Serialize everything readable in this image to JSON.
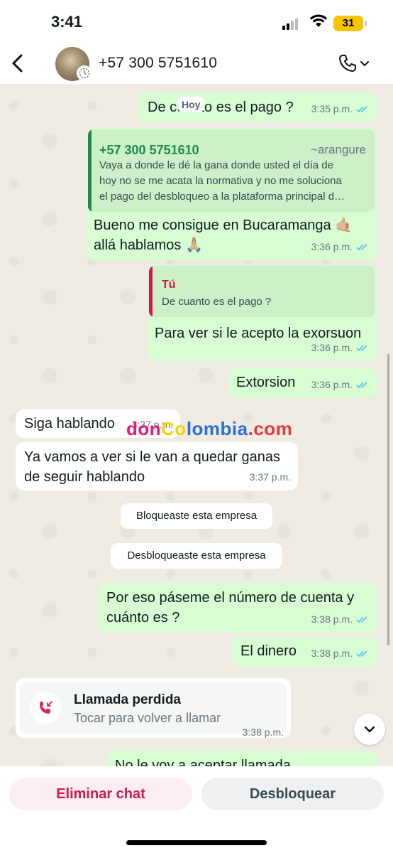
{
  "status_bar": {
    "time": "3:41",
    "battery": "31"
  },
  "header": {
    "contact": "+57 300 5751610"
  },
  "date_chip": "Hoy",
  "messages": {
    "m1": {
      "text": "De cuanto es el pago ?",
      "time": "3:35 p.m."
    },
    "m2": {
      "quote_name": "+57 300 5751610",
      "quote_alias": "~arangure",
      "quote_line1": "Vaya a donde le dé la gana donde usted el día de",
      "quote_line2": "hoy no se me acata la normativa y no me soluciona",
      "quote_line3": "el pago del desbloqueo a la plataforma principal d…",
      "line1": "Bueno me consigue en Bucaramanga 🤙🏼",
      "line2": "allá hablamos 🙏🏼",
      "time": "3:36 p.m."
    },
    "m3": {
      "quote_name": "Tú",
      "quote_text": "De cuanto es el pago ?",
      "text": "Para ver si le acepto la exorsuon",
      "time": "3:36 p.m."
    },
    "m4": {
      "text": "Extorsion",
      "time": "3:36 p.m."
    },
    "m5": {
      "text": "Siga hablando",
      "time": "3:37 p.m."
    },
    "m6": {
      "line1": "Ya vamos a ver si le van a quedar ganas",
      "line2": "de seguir hablando",
      "time": "3:37 p.m."
    },
    "m7": {
      "line1": "Por eso páseme el número de cuenta y",
      "line2": "cuánto es ?",
      "time": "3:38 p.m."
    },
    "m8": {
      "text": "El dinero",
      "time": "3:38 p.m."
    },
    "m9": {
      "text": "No le voy a aceptar llamada"
    }
  },
  "system": {
    "blocked": "Bloqueaste esta empresa",
    "unblocked": "Desbloqueaste esta empresa"
  },
  "missed_call": {
    "title": "Llamada perdida",
    "subtitle": "Tocar para volver a llamar",
    "time": "3:38 p.m."
  },
  "watermark": {
    "part1": "don",
    "part2": "Co",
    "part3": "lombia",
    "part4": ".com"
  },
  "bottom": {
    "delete_label": "Eliminar chat",
    "unblock_label": "Desbloquear"
  },
  "colors": {
    "outgoing": "#d9fdd3",
    "incoming": "#ffffff",
    "accent_green": "#1f8a4c",
    "tick_blue": "#53bdeb",
    "danger": "#d0184a"
  }
}
